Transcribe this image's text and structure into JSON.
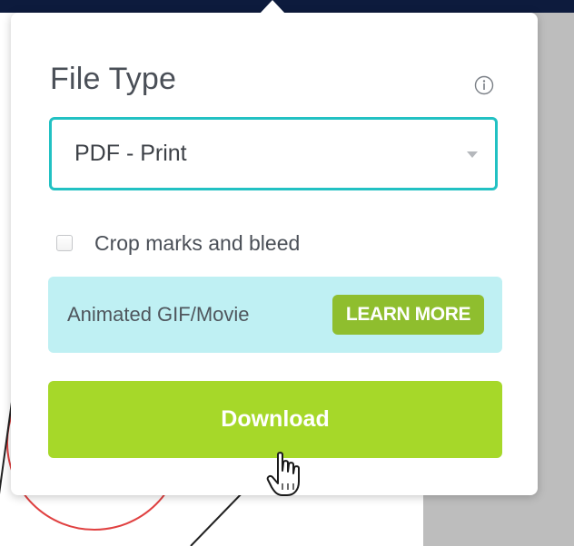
{
  "popup": {
    "title": "File Type",
    "info_icon": "info-icon",
    "file_type_select": {
      "value": "PDF - Print",
      "icon": "dropdown-caret-icon"
    },
    "crop_marks_checkbox": {
      "label": "Crop marks and bleed",
      "checked": false
    },
    "animated_banner": {
      "text": "Animated GIF/Movie",
      "button_label": "LEARN MORE"
    },
    "download_button": {
      "label": "Download"
    }
  },
  "colors": {
    "select_border": "#22c1c3",
    "banner_bg": "#bff0f3",
    "learn_more_bg": "#8fbe2e",
    "download_bg": "#a6d829",
    "top_bar": "#0d1b3d"
  },
  "cursor": {
    "type": "hand-pointer-cursor-icon"
  }
}
